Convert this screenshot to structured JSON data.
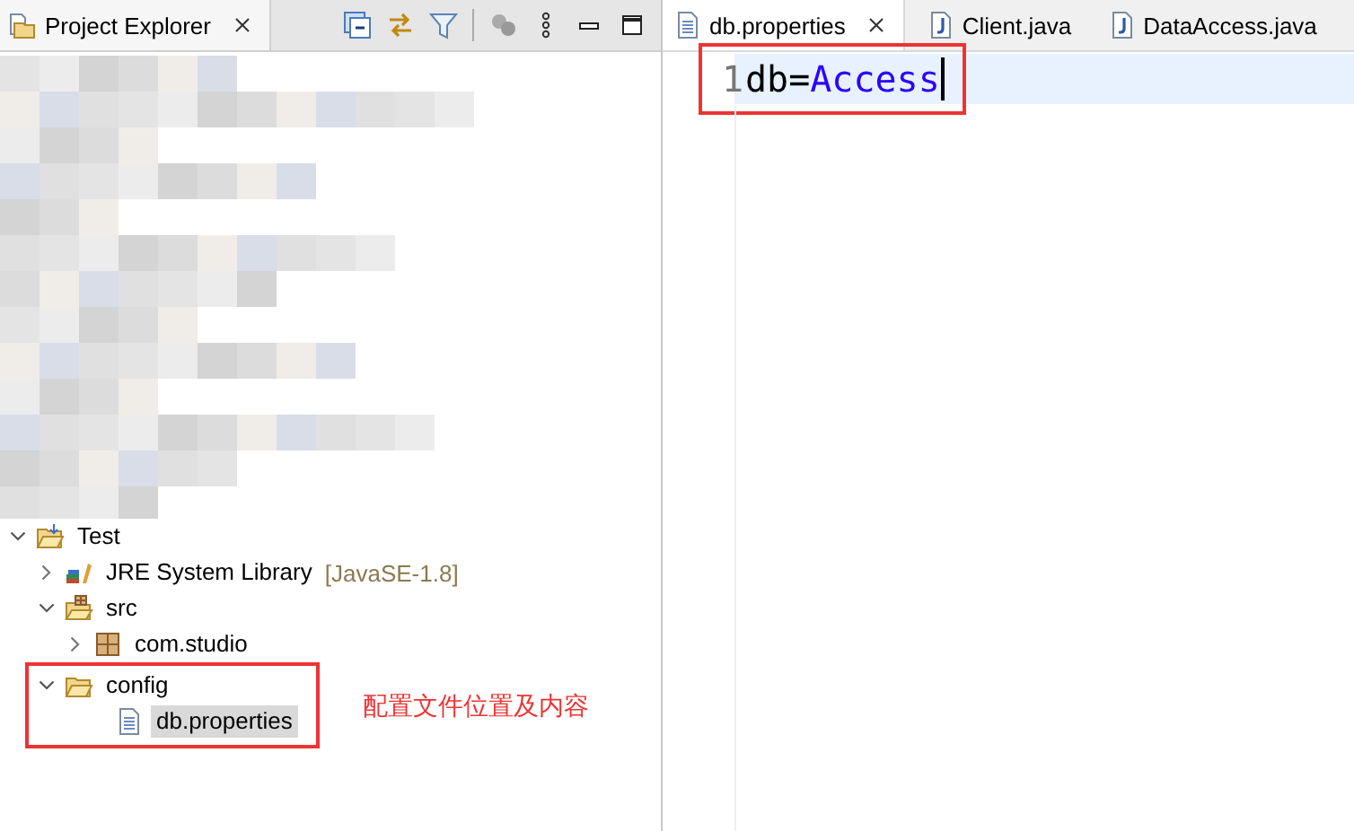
{
  "explorer": {
    "tab": {
      "label": "Project Explorer",
      "selected": true,
      "closable": true
    },
    "tree": [
      {
        "kind": "project",
        "label": "Test",
        "expanded": true,
        "selected": false,
        "children": [
          {
            "kind": "library",
            "label": "JRE System Library",
            "decoration": "[JavaSE-1.8]",
            "expanded": false,
            "selected": false
          },
          {
            "kind": "source-folder",
            "label": "src",
            "expanded": true,
            "selected": false,
            "children": [
              {
                "kind": "package",
                "label": "com.studio",
                "expanded": false,
                "selected": false
              }
            ]
          },
          {
            "kind": "folder",
            "label": "config",
            "expanded": true,
            "selected": false,
            "highlight_box": true,
            "note": "配置文件位置及内容",
            "children": [
              {
                "kind": "file",
                "label": "db.properties",
                "selected": true
              }
            ]
          }
        ]
      }
    ]
  },
  "editor": {
    "tabs": [
      {
        "label": "db.properties",
        "kind": "properties",
        "selected": true,
        "closable": true
      },
      {
        "label": "Client.java",
        "kind": "java",
        "selected": false,
        "closable": false
      },
      {
        "label": "DataAccess.java",
        "kind": "java",
        "selected": false,
        "closable": false
      }
    ],
    "lines": [
      {
        "number": "1",
        "key": "db",
        "separator": "=",
        "value": "Access",
        "current": true,
        "highlight_box": true
      }
    ]
  }
}
